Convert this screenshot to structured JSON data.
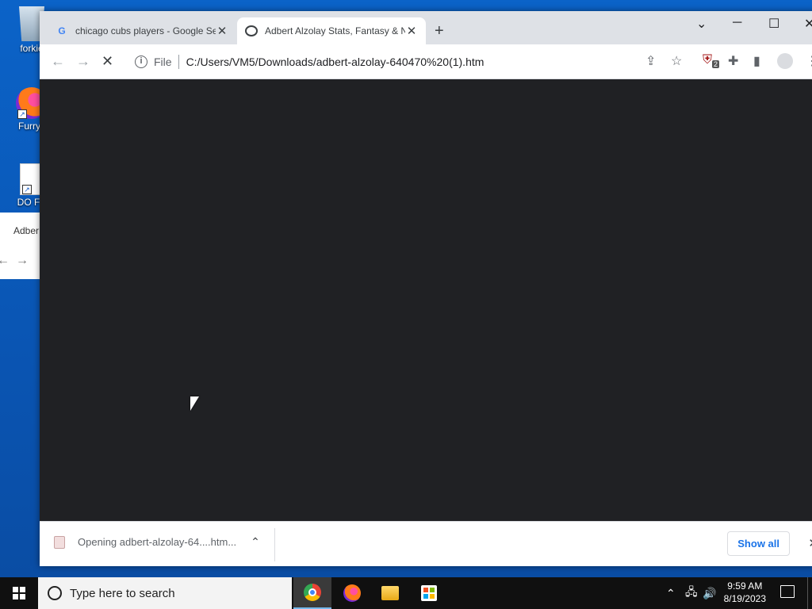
{
  "desktop": {
    "icons": [
      {
        "label": "forkie",
        "icon": "recycle-bin-icon"
      },
      {
        "label": "Furryfi",
        "icon": "firefox-icon"
      },
      {
        "label": "DO FY",
        "icon": "document-icon"
      }
    ],
    "background_window": {
      "tab_title": "Adber"
    }
  },
  "browser": {
    "tabs": [
      {
        "title": "chicago cubs players - Google Se",
        "favicon": "google-icon",
        "active": false
      },
      {
        "title": "Adbert Alzolay Stats, Fantasy & N",
        "favicon": "mlb-icon",
        "active": true
      }
    ],
    "address": {
      "scheme_label": "File",
      "url": "C:/Users/VM5/Downloads/adbert-alzolay-640470%20(1).htm"
    },
    "extension_badge": "2",
    "download_bar": {
      "item_text": "Opening adbert-alzolay-64....htm...",
      "show_all_label": "Show all"
    }
  },
  "taskbar": {
    "search_placeholder": "Type here to search",
    "time": "9:59 AM",
    "date": "8/19/2023"
  },
  "colors": {
    "accent": "#1a73e8",
    "content_bg": "#202124",
    "desktop_bg": "#0a55b3"
  }
}
